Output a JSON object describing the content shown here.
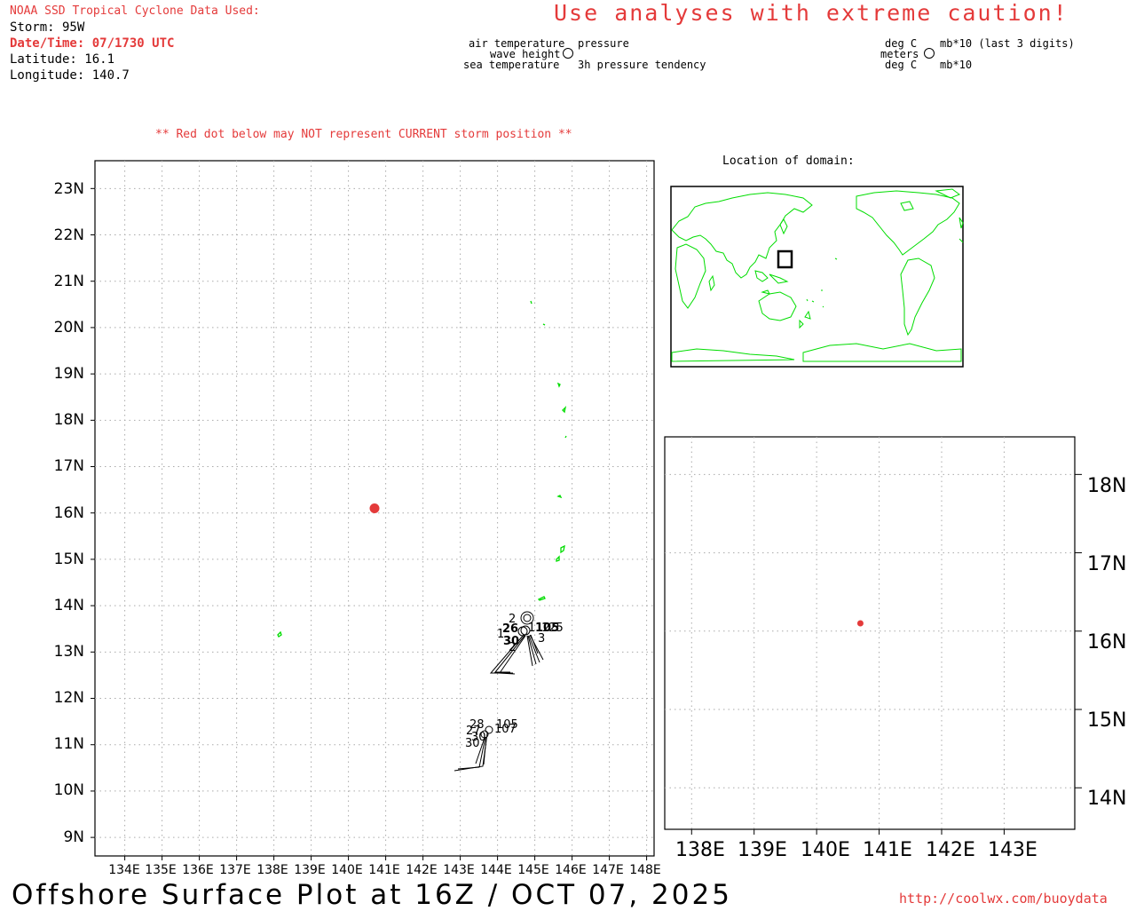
{
  "header": {
    "source_title": "NOAA SSD Tropical Cyclone Data Used:",
    "storm": "Storm: 95W",
    "datetime": "Date/Time: 07/1730 UTC",
    "latitude": "Latitude: 16.1",
    "longitude": "Longitude: 140.7",
    "caution": "Use analyses with extreme caution!",
    "red_dot_warning": "** Red dot below may NOT represent CURRENT storm position **"
  },
  "legend_left": {
    "air_temperature": "air temperature",
    "wave_height": "wave height",
    "sea_temperature": "sea temperature",
    "pressure": "pressure",
    "pressure_tendency": "3h pressure tendency"
  },
  "legend_right": {
    "deg_c_top": "deg C",
    "meters": "meters",
    "deg_c_bottom": "deg C",
    "mb_last3": "mb*10 (last 3 digits)",
    "mb10": "mb*10"
  },
  "inset_title": "Location of domain:",
  "main_map": {
    "lat_labels": [
      "23N",
      "22N",
      "21N",
      "20N",
      "19N",
      "18N",
      "17N",
      "16N",
      "15N",
      "14N",
      "13N",
      "12N",
      "11N",
      "10N",
      "9N"
    ],
    "lon_labels": [
      "134E",
      "135E",
      "136E",
      "137E",
      "138E",
      "139E",
      "140E",
      "141E",
      "142E",
      "143E",
      "144E",
      "145E",
      "146E",
      "147E",
      "148E"
    ],
    "storm_position": {
      "lat": 16.1,
      "lon": 140.7
    },
    "station_labels_north": [
      "2",
      "26",
      "112",
      "105",
      "125",
      "30",
      "1",
      "2",
      "3"
    ],
    "station_labels_south": [
      "28",
      "105",
      "27",
      "107",
      "30",
      "30"
    ]
  },
  "zoom_map": {
    "lat_labels": [
      "18N",
      "17N",
      "16N",
      "15N",
      "14N"
    ],
    "lon_labels": [
      "138E",
      "139E",
      "140E",
      "141E",
      "142E",
      "143E"
    ]
  },
  "footer": {
    "plot_title": "Offshore Surface Plot at 16Z / OCT 07, 2025",
    "url": "http://coolwx.com/buoydata"
  },
  "colors": {
    "accent_red": "#e43a3a",
    "coast_green": "#00dd00",
    "grid": "#aaaaaa"
  }
}
